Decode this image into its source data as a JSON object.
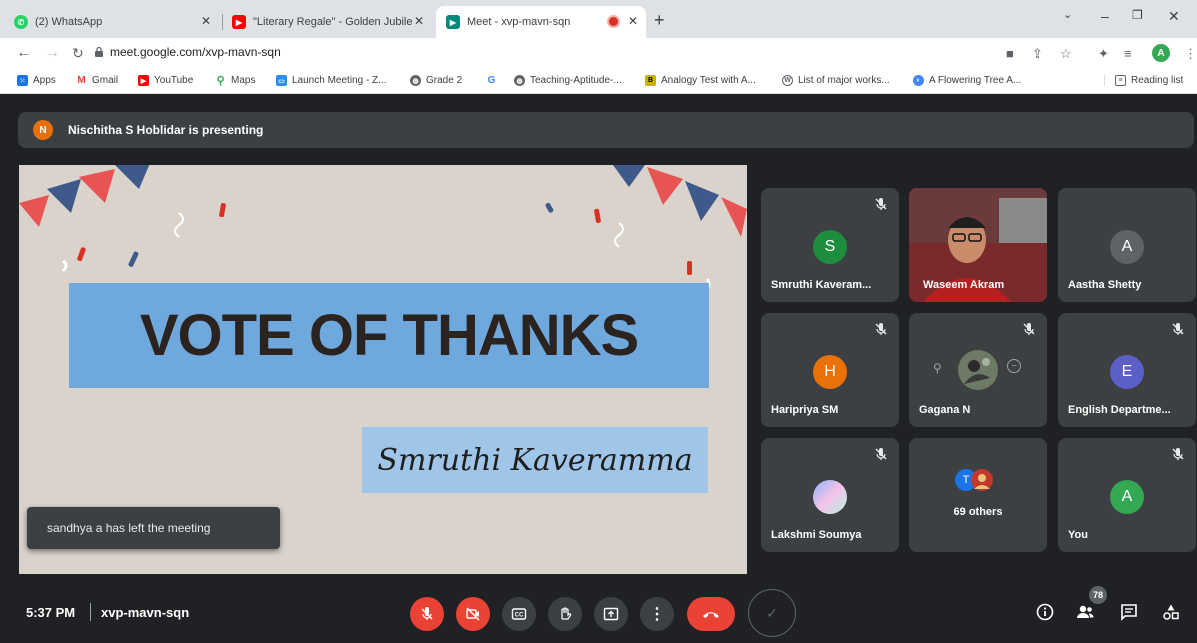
{
  "browser": {
    "tabs": [
      {
        "title": "(2) WhatsApp",
        "color": "#25d366"
      },
      {
        "title": "\"Literary Regale\" - Golden Jubile",
        "color": "#ff0000"
      },
      {
        "title": "Meet - xvp-mavn-sqn",
        "color": "#00897b"
      }
    ],
    "url": "meet.google.com/xvp-mavn-sqn",
    "profile_initial": "A",
    "bookmarks": [
      {
        "label": "Apps"
      },
      {
        "label": "Gmail"
      },
      {
        "label": "YouTube"
      },
      {
        "label": "Maps"
      },
      {
        "label": "Launch Meeting - Z..."
      },
      {
        "label": "Grade 2"
      },
      {
        "label": "Teaching-Aptitude-..."
      },
      {
        "label": "Analogy Test with A..."
      },
      {
        "label": "List of major works..."
      },
      {
        "label": "A Flowering Tree A..."
      },
      {
        "label": "Reading list"
      }
    ]
  },
  "meet": {
    "presenter_initial": "N",
    "presenter_text": "Nischitha S Hoblidar is presenting",
    "slide": {
      "title": "VOTE OF THANKS",
      "name": "Smruthi Kaveramma"
    },
    "toast": "sandhya a has left the meeting",
    "participants": [
      {
        "name": "Smruthi Kaveram...",
        "initial": "S",
        "color": "#1e8e3e"
      },
      {
        "name": "Waseem Akram",
        "initial": "",
        "color": ""
      },
      {
        "name": "Aastha Shetty",
        "initial": "A",
        "color": "#5f6368"
      },
      {
        "name": "Haripriya SM",
        "initial": "H",
        "color": "#e8710a"
      },
      {
        "name": "Gagana N",
        "initial": "",
        "color": "#5f6368"
      },
      {
        "name": "English Departme...",
        "initial": "E",
        "color": "#5b5fc7"
      },
      {
        "name": "Lakshmi Soumya",
        "initial": "",
        "color": ""
      },
      {
        "name": "69 others",
        "initial": "T",
        "color": "#1a73e8"
      },
      {
        "name": "You",
        "initial": "A",
        "color": "#34a853"
      }
    ],
    "time": "5:37 PM",
    "meeting_code": "xvp-mavn-sqn",
    "people_count": "78"
  }
}
